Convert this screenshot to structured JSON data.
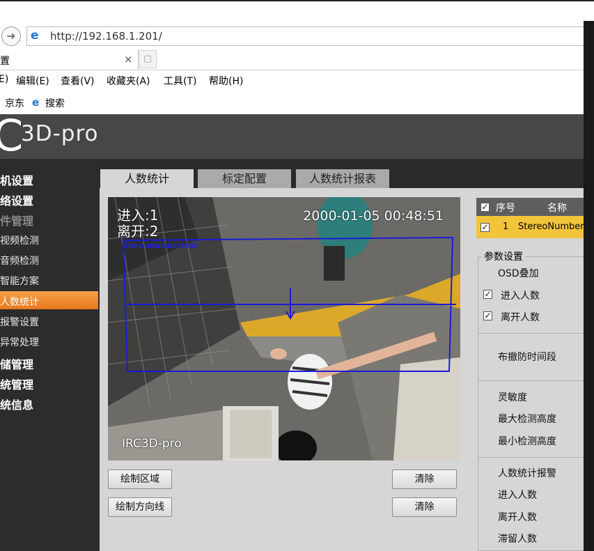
{
  "browser": {
    "url": "http://192.168.1.201/",
    "tab_title": "置",
    "tab_close": "×",
    "menus": [
      "E)",
      "编辑(E)",
      "查看(V)",
      "收藏夹(A)",
      "工具(T)",
      "帮助(H)"
    ],
    "favorites": [
      "京东",
      "搜索"
    ]
  },
  "app": {
    "logo_mark": "C",
    "product": "3D-pro",
    "nav": [
      {
        "label": "机设置"
      },
      {
        "label": "络设置"
      },
      {
        "label": "件管理"
      },
      {
        "label": "视频检测"
      },
      {
        "label": "音频检测"
      },
      {
        "label": "智能方案"
      },
      {
        "label": "人数统计"
      },
      {
        "label": "报警设置"
      },
      {
        "label": "异常处理"
      },
      {
        "label": "储管理"
      },
      {
        "label": "统管理"
      },
      {
        "label": "统信息"
      }
    ],
    "tabs": [
      "人数统计",
      "标定配置",
      "人数统计报表"
    ],
    "video": {
      "osd_in": "进入:1",
      "osd_out": "离开:2",
      "osd_time": "2000-01-05 00:48:51",
      "osd_tiny": "StereoNumberStat",
      "osd_name": "IRC3D-pro"
    },
    "buttons": {
      "draw_area": "绘制区域",
      "clear_area": "清除",
      "draw_direction": "绘制方向线",
      "clear_direction": "清除"
    },
    "list": {
      "col_index": "序号",
      "col_name": "名称",
      "row_index": "1",
      "row_name": "StereoNumberS"
    },
    "params": {
      "legend": "参数设置",
      "osd": "OSD叠加",
      "enter_count": "进入人数",
      "leave_count": "离开人数",
      "arm_period": "布撤防时间段",
      "sensitivity": "灵敏度",
      "max_height": "最大检测高度",
      "min_height": "最小检测高度",
      "alarm": "人数统计报警",
      "alarm_enter": "进入人数",
      "alarm_leave": "离开人数",
      "alarm_stay": "滞留人数"
    }
  }
}
